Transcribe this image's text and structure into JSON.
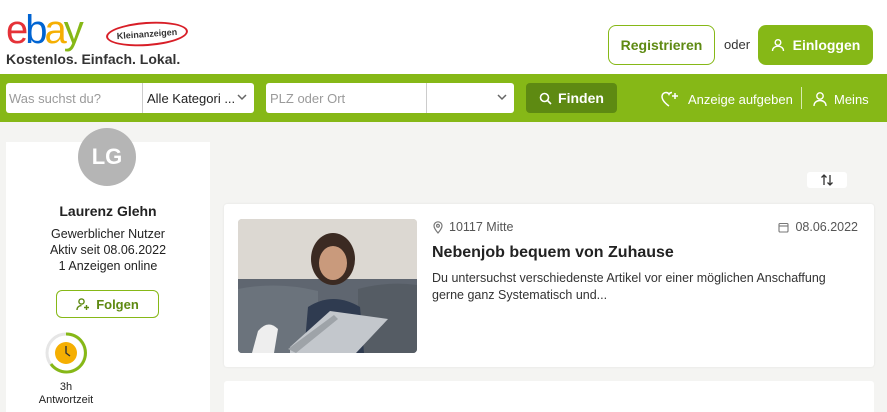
{
  "header": {
    "logo_ebay": "ebay",
    "logo_badge": "Kleinanzeigen",
    "tagline": "Kostenlos. Einfach. Lokal.",
    "register_label": "Registrieren",
    "or_label": "oder",
    "login_label": "Einloggen"
  },
  "search": {
    "query_placeholder": "Was suchst du?",
    "category_value": "Alle Kategori ...",
    "location_placeholder": "PLZ oder Ort",
    "radius_value": "",
    "find_label": "Finden",
    "post_ad_label": "Anzeige aufgeben",
    "mine_label": "Meins"
  },
  "profile": {
    "initials": "LG",
    "name": "Laurenz Glehn",
    "user_type": "Gewerblicher Nutzer",
    "active_since": "Aktiv seit 08.06.2022",
    "ads_online": "1 Anzeigen online",
    "follow_label": "Folgen",
    "response_time_value": "3h",
    "response_time_label": "Antwortzeit"
  },
  "sort": {
    "icon": "sort-arrows-icon"
  },
  "ads": [
    {
      "location": "10117 Mitte",
      "date": "08.06.2022",
      "title": "Nebenjob bequem von Zuhause",
      "description": "Du untersuchst verschiedenste Artikel vor einer möglichen Anschaffung gerne ganz Systematisch und..."
    }
  ],
  "colors": {
    "brand_green": "#86b817",
    "dark_green": "#5e8a12",
    "ebay_red": "#e53238",
    "ebay_blue": "#0064d2",
    "ebay_yellow": "#f5af02"
  }
}
